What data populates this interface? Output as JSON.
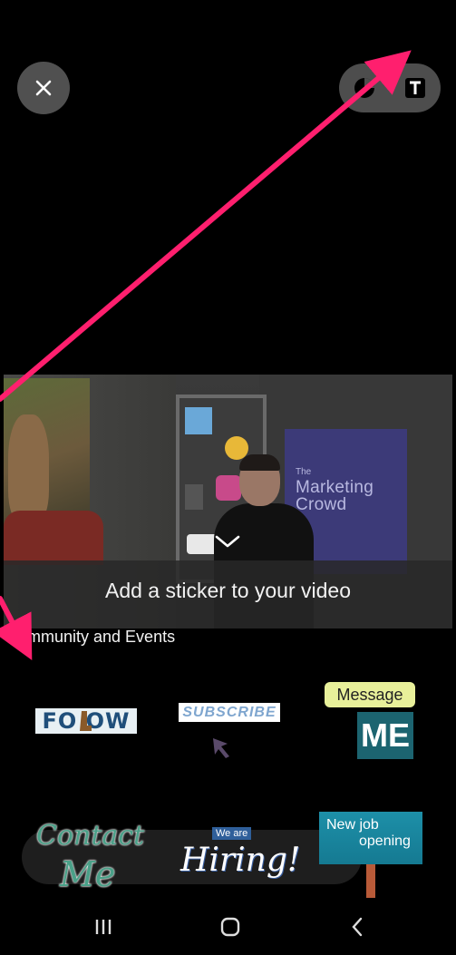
{
  "editor": {
    "close_icon": "close-icon",
    "tools": [
      "effects-icon",
      "text-tool-icon"
    ]
  },
  "video_preview": {
    "brand_sign": {
      "small": "The",
      "line1": "Marketing",
      "line2": "Crowd"
    },
    "collapse_icon": "chevron-down-icon",
    "caption": "Add a sticker to your video"
  },
  "sticker_panel": {
    "section_title": "ommunity and Events",
    "stickers": {
      "follow": "FO  OW",
      "subscribe": "SUBSCRIBE",
      "message": "Message",
      "me": "ME",
      "contact_line1": "Contact",
      "contact_line2": "Me",
      "we_are": "We are",
      "hiring": "Hiring!",
      "billboard_line1": "New job",
      "billboard_line2": "opening"
    }
  },
  "annotation_colors": {
    "arrow": "#ff1f6e"
  },
  "system_nav": [
    "recent-apps-icon",
    "home-icon",
    "back-icon"
  ]
}
